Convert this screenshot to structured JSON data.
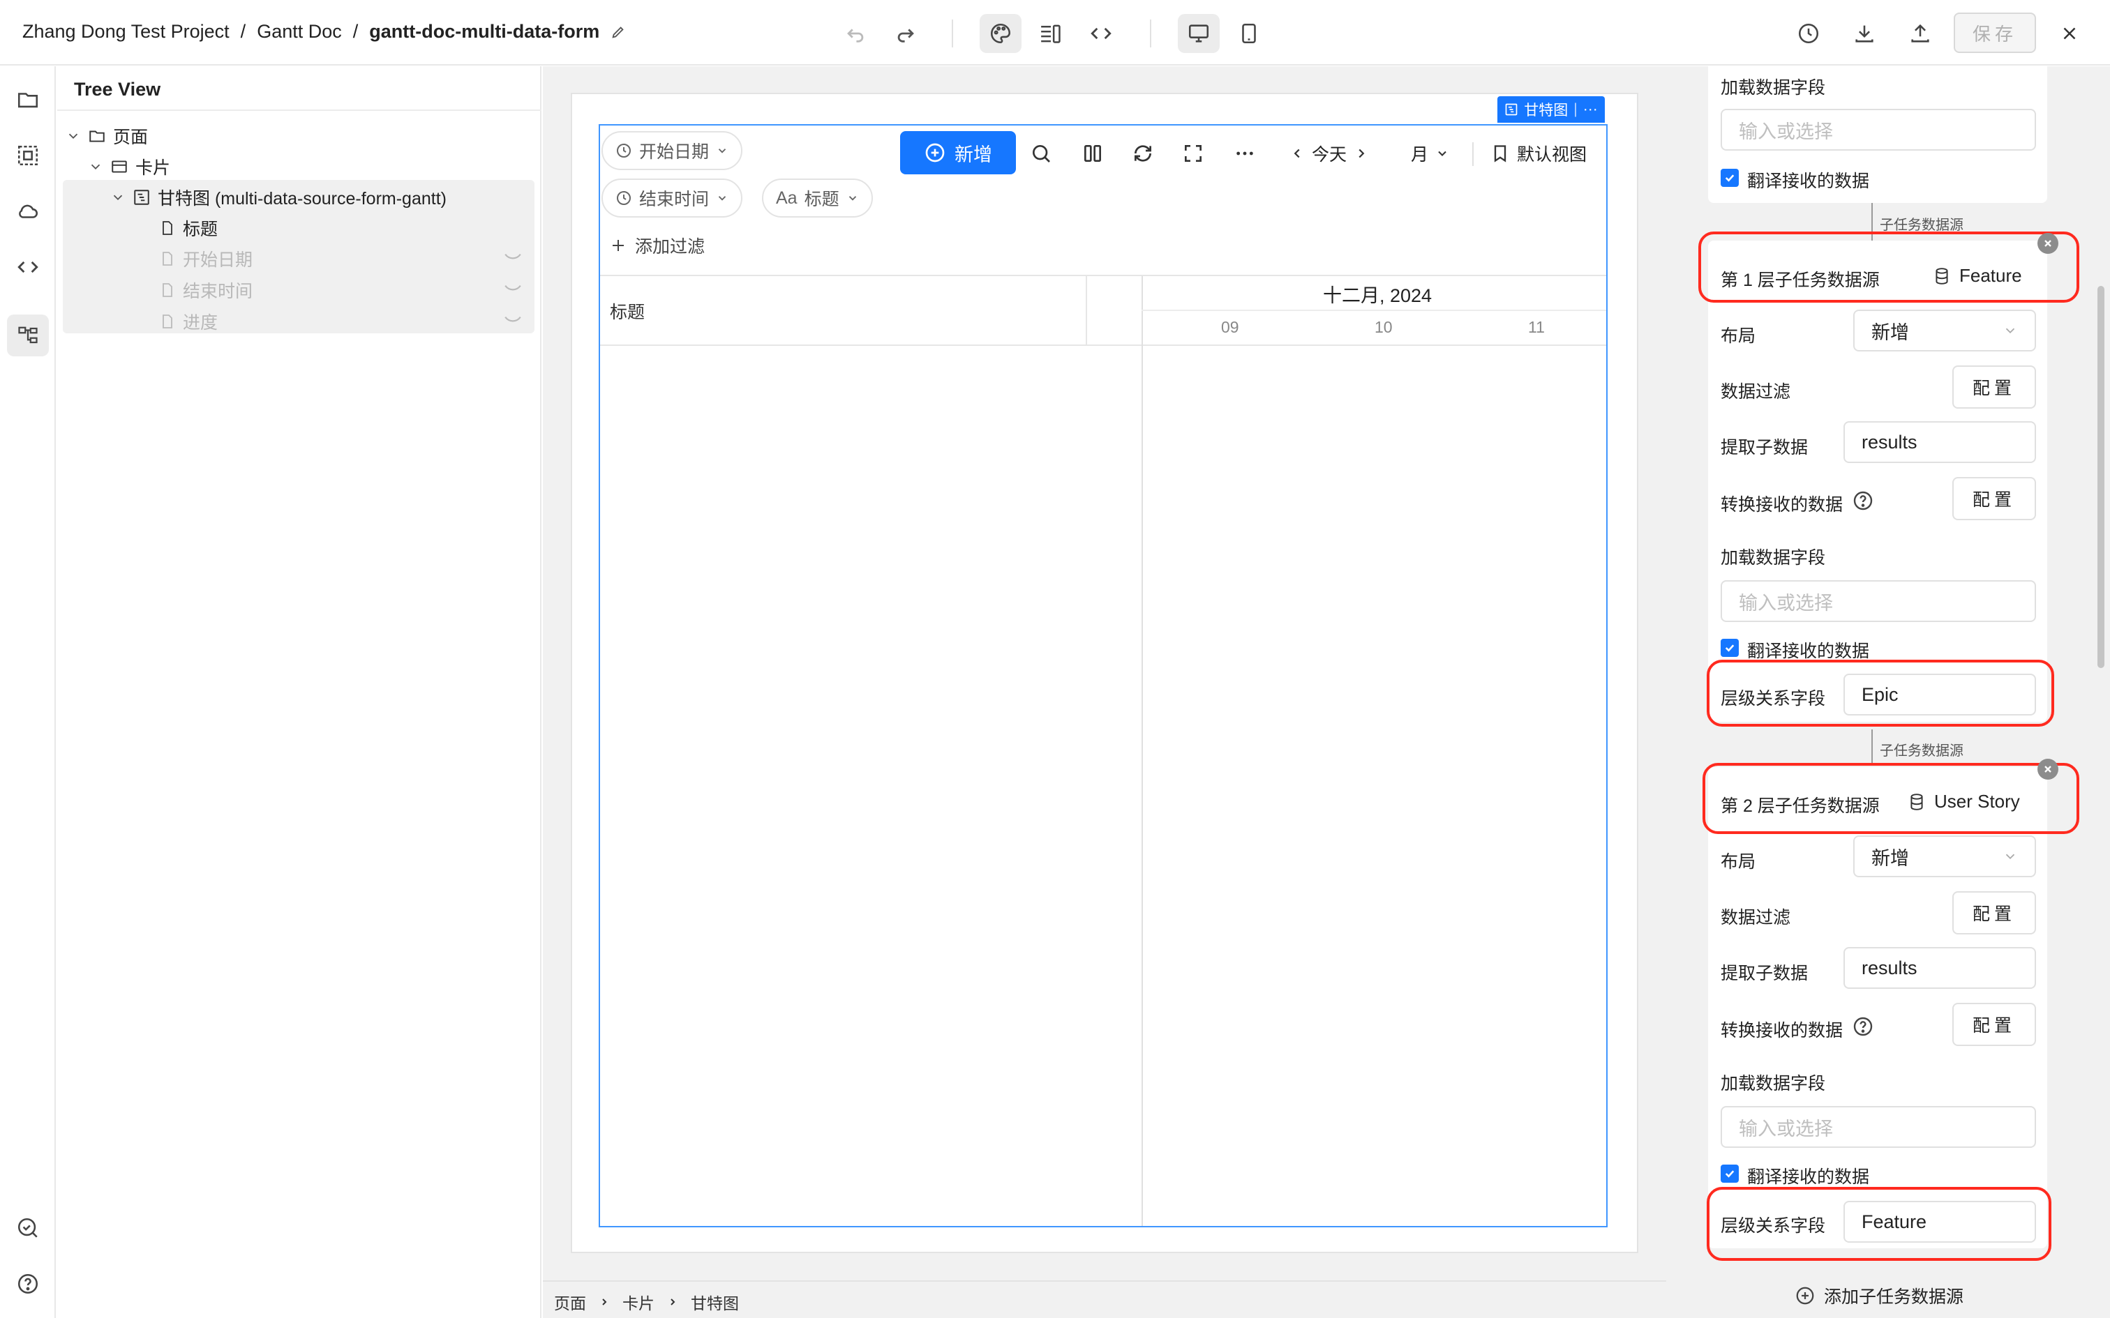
{
  "breadcrumb": {
    "project": "Zhang Dong Test Project",
    "doc": "Gantt Doc",
    "page": "gantt-doc-multi-data-form"
  },
  "toolbar": {
    "save_label": "保存"
  },
  "tree": {
    "title": "Tree View",
    "items": [
      {
        "label": "页面"
      },
      {
        "label": "卡片"
      },
      {
        "label": "甘特图 (multi-data-source-form-gantt)"
      },
      {
        "label": "标题"
      },
      {
        "label": "开始日期"
      },
      {
        "label": "结束时间"
      },
      {
        "label": "进度"
      }
    ]
  },
  "gantt": {
    "tag_label": "甘特图",
    "chips": {
      "start_date": "开始日期",
      "end_time": "结束时间",
      "title_field": "标题"
    },
    "add_label": "新增",
    "today_label": "今天",
    "month_label": "月",
    "default_view_label": "默认视图",
    "add_filter_label": "添加过滤",
    "table_header": "标题",
    "month_header": "十二月, 2024",
    "days": [
      "09",
      "10",
      "11"
    ]
  },
  "bottom_breadcrumb": [
    "页面",
    "卡片",
    "甘特图"
  ],
  "right_panel": {
    "top_section": {
      "load_fields_label": "加载数据字段",
      "load_fields_placeholder": "输入或选择",
      "translate_label": "翻译接收的数据"
    },
    "connector_label": "子任务数据源",
    "levels": [
      {
        "title": "第 1 层子任务数据源",
        "source": "Feature",
        "layout_label": "布局",
        "layout_value": "新增",
        "filter_label": "数据过滤",
        "config_label": "配置",
        "extract_label": "提取子数据",
        "extract_value": "results",
        "transform_label": "转换接收的数据",
        "load_fields_label": "加载数据字段",
        "load_fields_placeholder": "输入或选择",
        "translate_label": "翻译接收的数据",
        "hierarchy_label": "层级关系字段",
        "hierarchy_value": "Epic"
      },
      {
        "title": "第 2 层子任务数据源",
        "source": "User Story",
        "layout_label": "布局",
        "layout_value": "新增",
        "filter_label": "数据过滤",
        "config_label": "配置",
        "extract_label": "提取子数据",
        "extract_value": "results",
        "transform_label": "转换接收的数据",
        "load_fields_label": "加载数据字段",
        "load_fields_placeholder": "输入或选择",
        "translate_label": "翻译接收的数据",
        "hierarchy_label": "层级关系字段",
        "hierarchy_value": "Feature"
      }
    ],
    "add_sub_source_label": "添加子任务数据源"
  },
  "colors": {
    "primary": "#1677ff",
    "highlight_box": "#ff2a1f",
    "checkbox": "#1677ff"
  }
}
